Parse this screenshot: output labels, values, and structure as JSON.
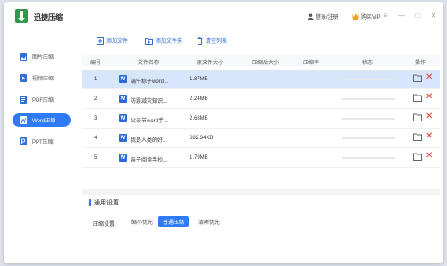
{
  "app": {
    "title": "迅捷压缩"
  },
  "header": {
    "login": "登录/注册",
    "vip": "购买VIP"
  },
  "sidebar": {
    "items": [
      {
        "label": "图片压缩",
        "icon": "image-icon",
        "active": false
      },
      {
        "label": "视频压缩",
        "icon": "video-icon",
        "active": false
      },
      {
        "label": "PDF压缩",
        "icon": "pdf-icon",
        "active": false
      },
      {
        "label": "Word压缩",
        "icon": "word-icon",
        "active": true
      },
      {
        "label": "PPT压缩",
        "icon": "ppt-icon",
        "active": false
      }
    ]
  },
  "toolbar": {
    "add_file": "添加文件",
    "add_folder": "添加文件夹",
    "clear_list": "清空列表"
  },
  "table": {
    "columns": [
      "编号",
      "文件名称",
      "原文件大小",
      "压缩后大小",
      "压缩率",
      "状态",
      "操作"
    ],
    "rows": [
      {
        "num": "1",
        "name": "端午粽子word...",
        "size": "1.87MB"
      },
      {
        "num": "2",
        "name": "防震减灾知识...",
        "size": "2.24MB"
      },
      {
        "num": "3",
        "name": "父亲节word手...",
        "size": "2.68MB"
      },
      {
        "num": "4",
        "name": "我是人类的好...",
        "size": "682.34KB"
      },
      {
        "num": "5",
        "name": "亲子阅读手抄...",
        "size": "1.79MB"
      }
    ]
  },
  "settings": {
    "title": "通用设置",
    "compress_label": "压缩设置:",
    "options": [
      "缩小优先",
      "普通压缩",
      "清晰优先"
    ],
    "selected": "普通压缩"
  },
  "colors": {
    "accent": "#2f7bf6",
    "selected_row": "#d8e6fb",
    "delete": "#e53935"
  }
}
